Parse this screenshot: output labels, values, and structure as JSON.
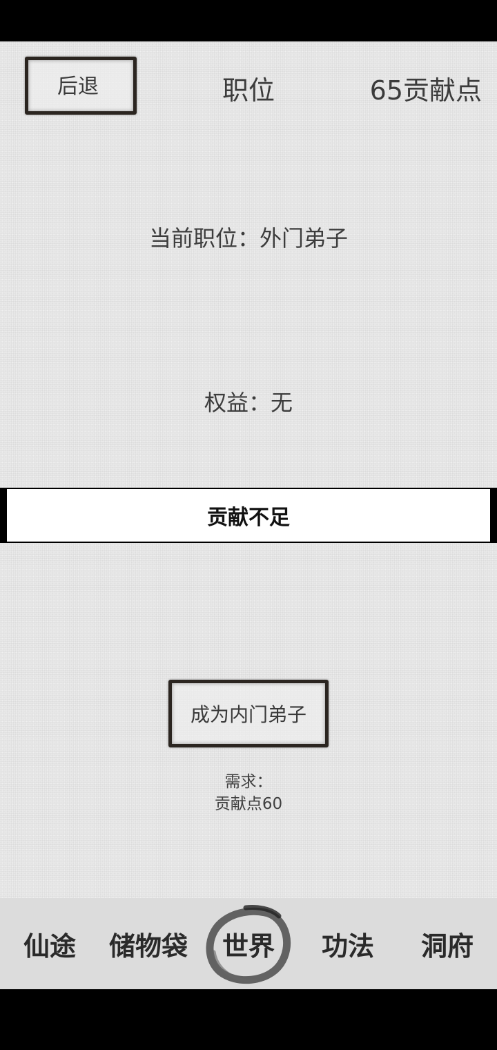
{
  "header": {
    "back_label": "后退",
    "title": "职位",
    "points": "65贡献点"
  },
  "info": {
    "current_position": "当前职位：外门弟子",
    "benefits": "权益：无"
  },
  "banner": {
    "message": "贡献不足"
  },
  "promotion": {
    "button_label": "成为内门弟子",
    "requirement_heading": "需求：",
    "requirement_detail": "贡献点60"
  },
  "nav": {
    "items": [
      {
        "label": "仙途"
      },
      {
        "label": "储物袋"
      },
      {
        "label": "世界"
      },
      {
        "label": "功法"
      },
      {
        "label": "洞府"
      }
    ],
    "active_index": 2
  }
}
